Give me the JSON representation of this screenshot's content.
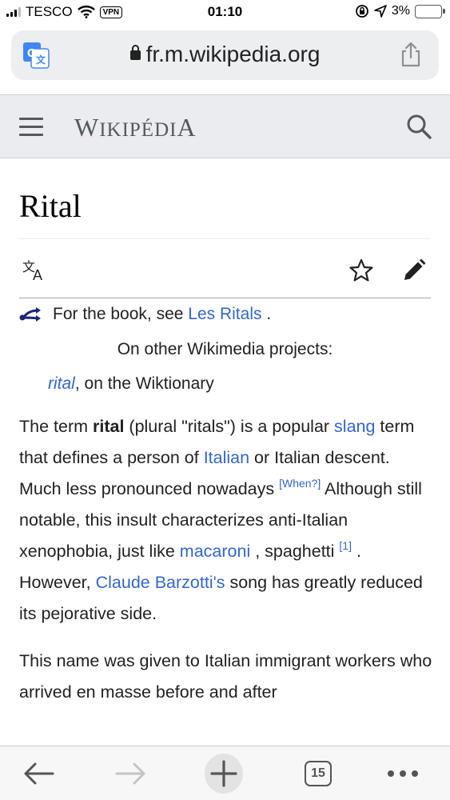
{
  "status_bar": {
    "carrier": "TESCO",
    "vpn": "VPN",
    "time": "01:10",
    "battery": "3%"
  },
  "browser": {
    "url": "fr.m.wikipedia.org",
    "open_tabs": "15"
  },
  "wiki": {
    "logo_first": "W",
    "logo_rest": "IKIPÉDI",
    "logo_last": "A"
  },
  "article": {
    "title": "Rital",
    "hatnote_prefix": "For the book, see",
    "hatnote_link": "Les Ritals",
    "hatnote_suffix": ".",
    "sister_title": "On other Wikimedia projects:",
    "sister_link": "rital",
    "sister_suffix": ", on the Wiktionary",
    "p1": {
      "t1": "The term ",
      "bold": "rital",
      "t2": " (plural \"ritals\") is a popular ",
      "link_slang": "slang",
      "t3": " term that defines a person of ",
      "link_italian": "Italian",
      "t4": " or Italian descent. Much less pronounced nowadays ",
      "when_tag": "[When?]",
      "t5": " Although still notable, this insult characterizes anti-Italian xenophobia, just like ",
      "link_macaroni": "macaroni",
      "t6": " , spaghetti ",
      "ref": "[1]",
      "t7": " . However, ",
      "link_barzotti": "Claude Barzotti's",
      "t8": " song has greatly reduced its pejorative side."
    },
    "p2": "This name was given to Italian immigrant workers who arrived en masse before and after"
  },
  "colors": {
    "link": "#3366cc",
    "header_bg": "#eaecf0",
    "battery_fill": "#f2b400"
  }
}
